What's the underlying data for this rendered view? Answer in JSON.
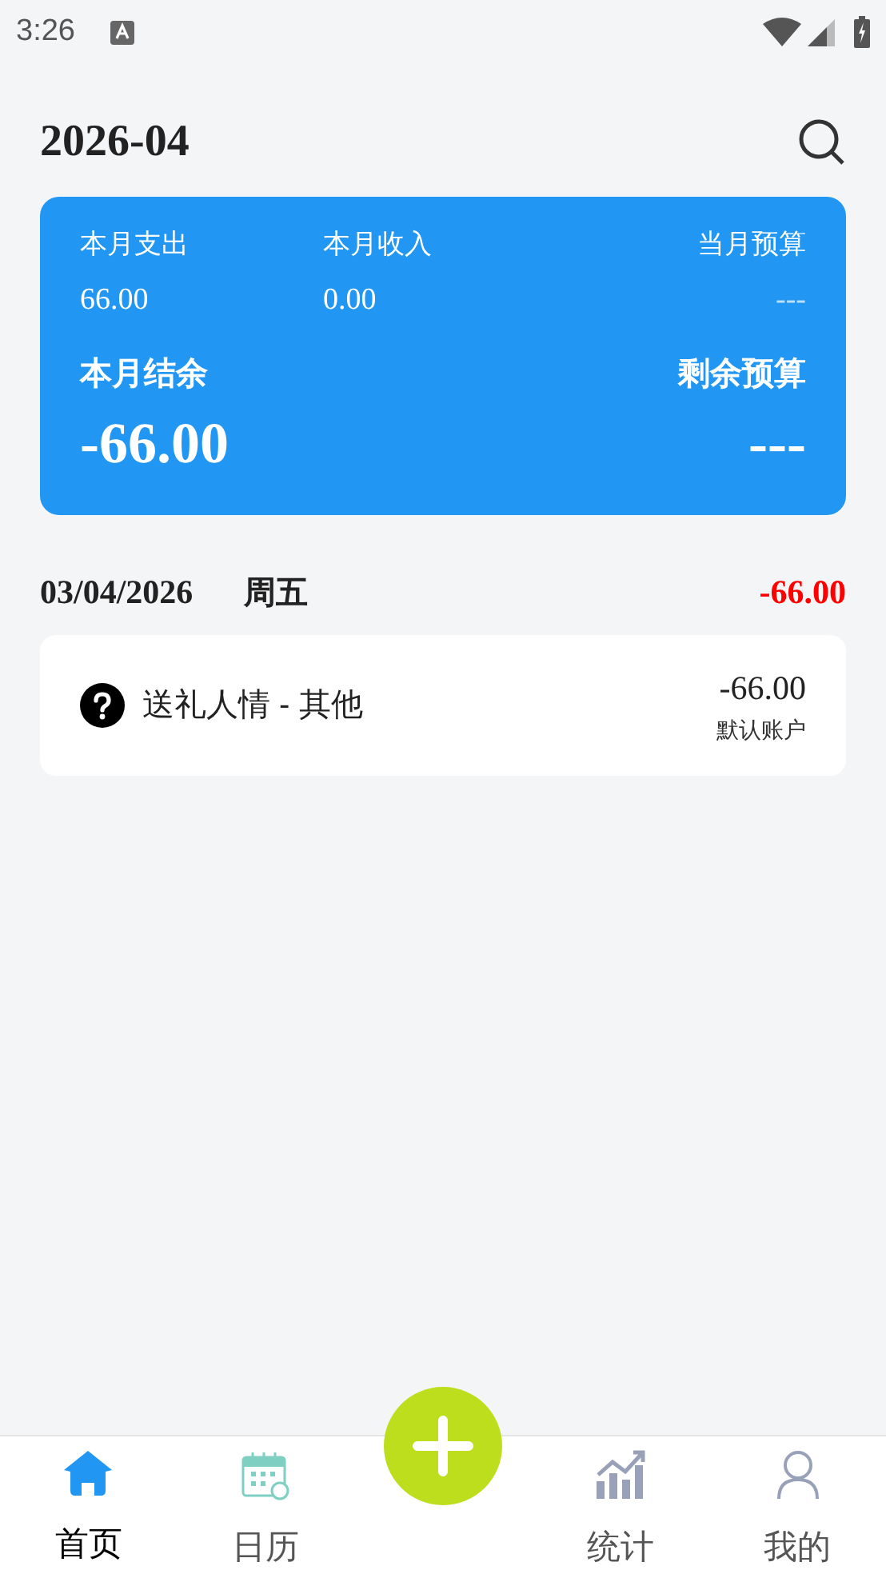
{
  "status_bar": {
    "time": "3:26"
  },
  "header": {
    "title": "2026-04"
  },
  "summary": {
    "top": [
      {
        "label": "本月支出",
        "value": "66.00"
      },
      {
        "label": "本月收入",
        "value": "0.00"
      },
      {
        "label": "当月预算",
        "value": "---"
      }
    ],
    "bottom": [
      {
        "label": "本月结余",
        "value": "-66.00"
      },
      {
        "label": "剩余预算",
        "value": "---"
      }
    ]
  },
  "days": [
    {
      "date": "03/04/2026",
      "weekday": "周五",
      "total": "-66.00",
      "entries": [
        {
          "title": "送礼人情 - 其他",
          "amount": "-66.00",
          "account": "默认账户"
        }
      ]
    }
  ],
  "nav": [
    {
      "kind": "home",
      "label": "首页",
      "selected": true
    },
    {
      "kind": "calendar",
      "label": "日历",
      "selected": false
    },
    {
      "kind": "add"
    },
    {
      "kind": "stats",
      "label": "统计",
      "selected": false
    },
    {
      "kind": "profile",
      "label": "我的",
      "selected": false
    }
  ]
}
